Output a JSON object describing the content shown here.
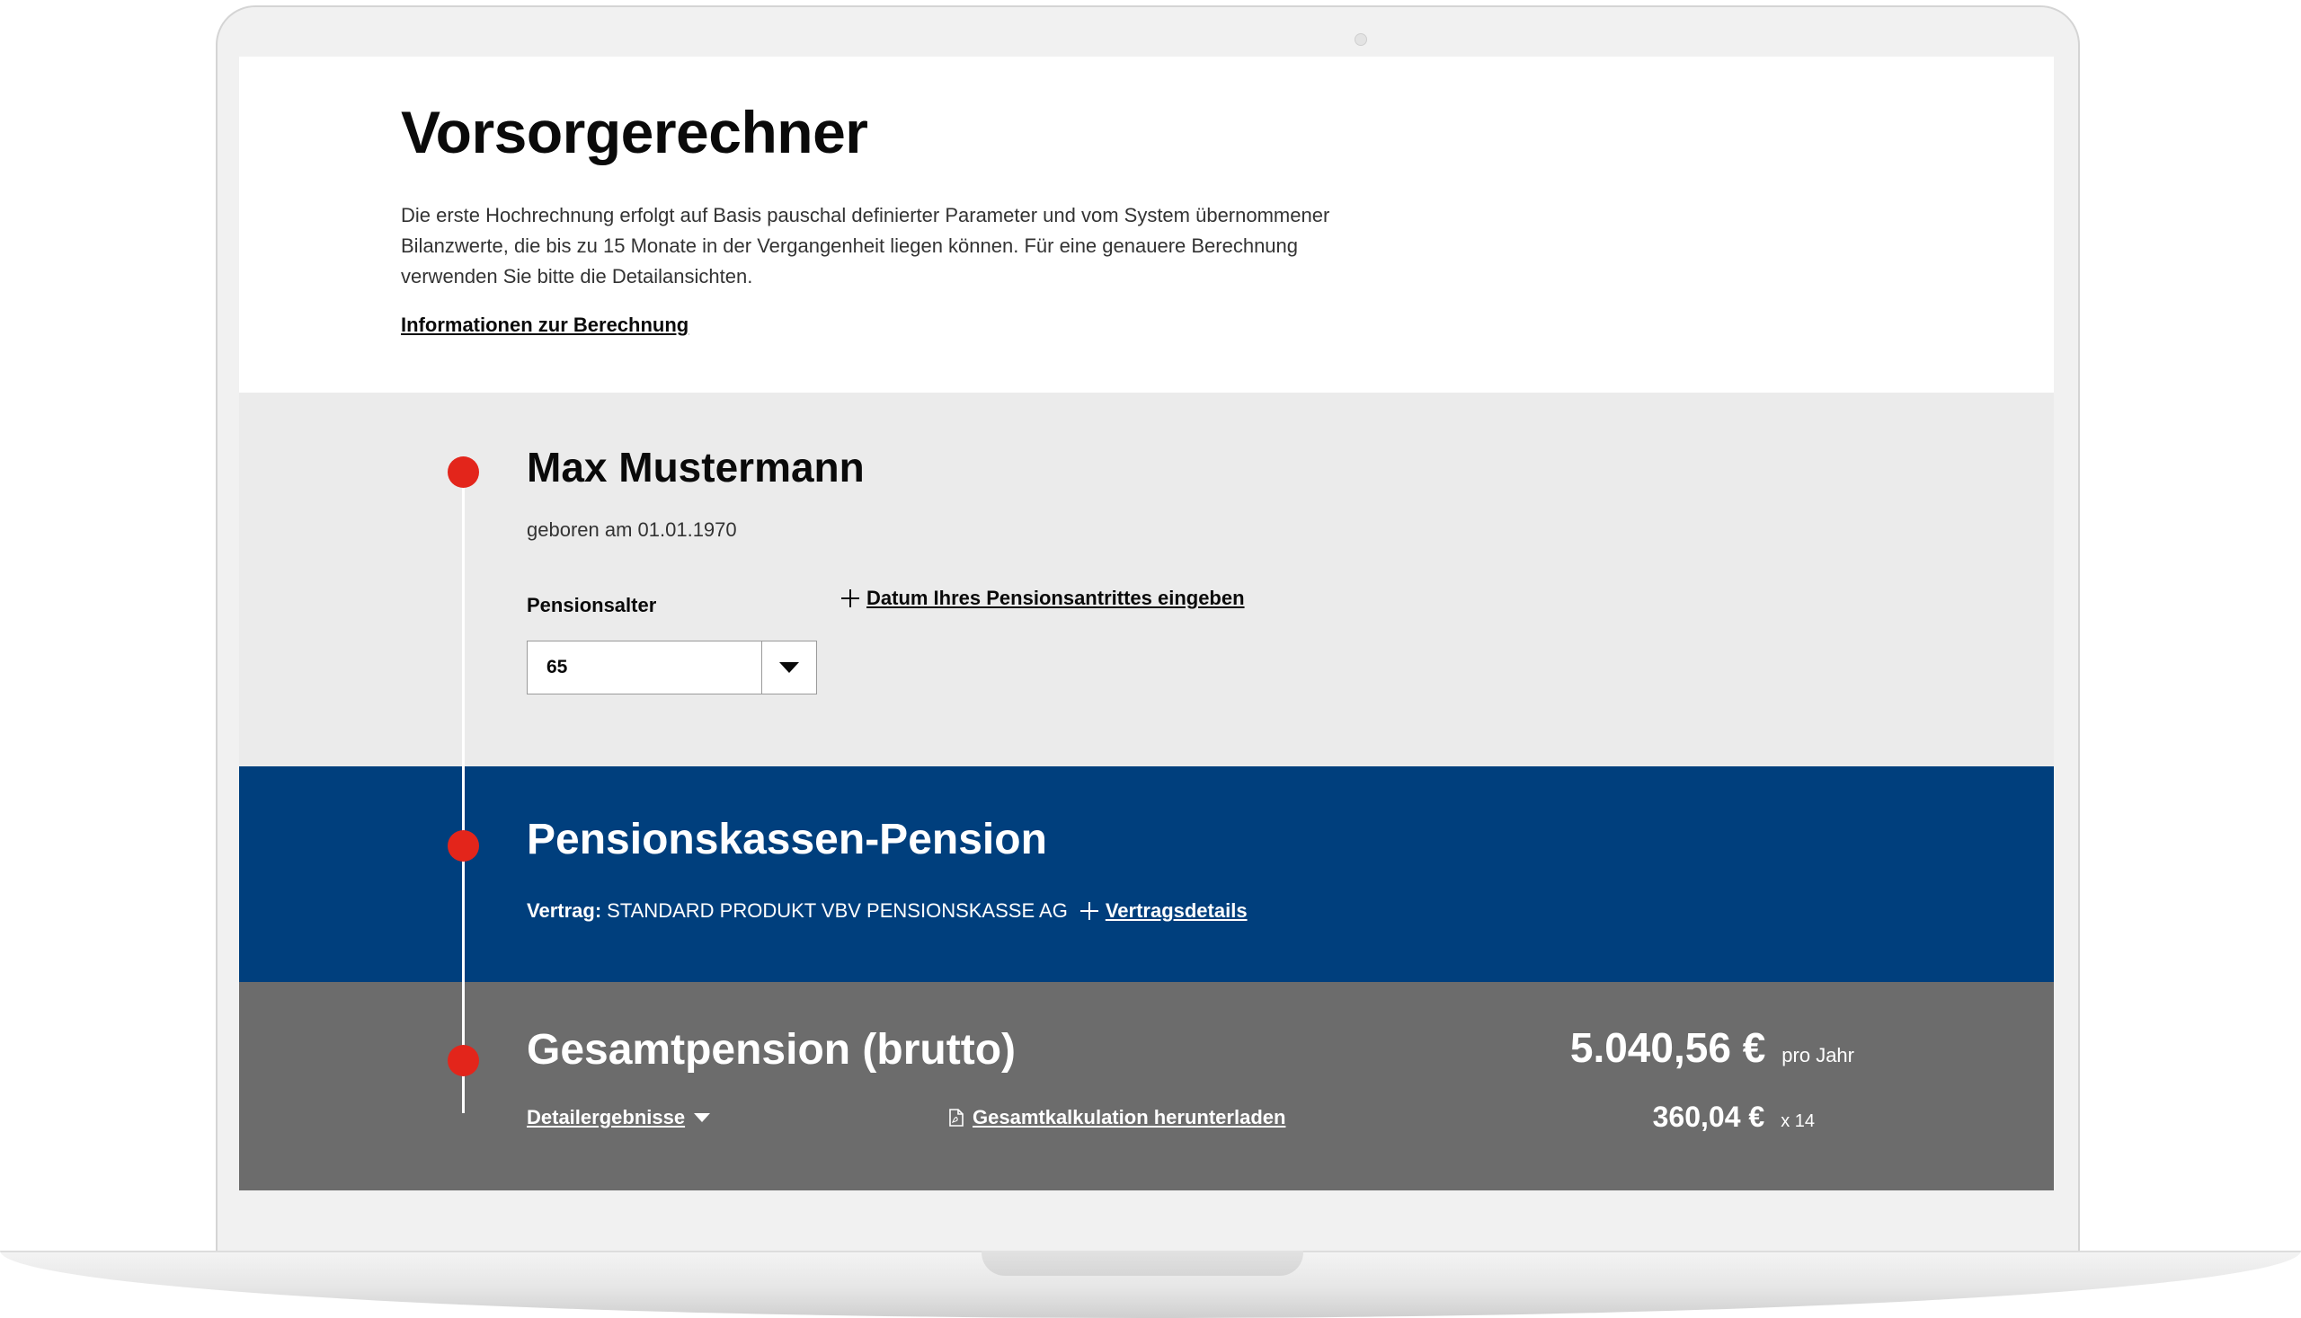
{
  "intro": {
    "title": "Vorsorgerechner",
    "description": "Die erste Hochrechnung erfolgt auf Basis pauschal definierter Parameter und vom System übernommener Bilanzwerte, die bis zu 15 Monate in der Vergangenheit liegen können. Für eine genauere Berechnung verwenden Sie bitte die Detailansichten.",
    "info_link": "Informationen zur Berechnung"
  },
  "person": {
    "name": "Max Mustermann",
    "birth": "geboren am 01.01.1970",
    "pension_age_label": "Pensionsalter",
    "pension_age_value": "65",
    "add_date_link": "Datum Ihres Pensionsantrittes eingeben"
  },
  "fund": {
    "title": "Pensionskassen-Pension",
    "contract_label": "Vertrag:",
    "contract_value": "STANDARD PRODUKT VBV PENSIONSKASSE AG",
    "details_link": "Vertragsdetails"
  },
  "total": {
    "title": "Gesamtpension (brutto)",
    "details_toggle": "Detailergebnisse",
    "download_link": "Gesamtkalkulation herunterladen",
    "annual_value": "5.040,56 €",
    "annual_unit": "pro Jahr",
    "monthly_value": "360,04 €",
    "monthly_unit": "x 14"
  },
  "colors": {
    "accent_red": "#e3251b",
    "fund_blue": "#003f7d",
    "total_grey": "#6c6c6c",
    "person_bg": "#ebebeb"
  },
  "icons": {
    "add": "plus-icon",
    "select": "chevron-down-icon",
    "details": "caret-down-icon",
    "download": "pdf-file-icon"
  }
}
